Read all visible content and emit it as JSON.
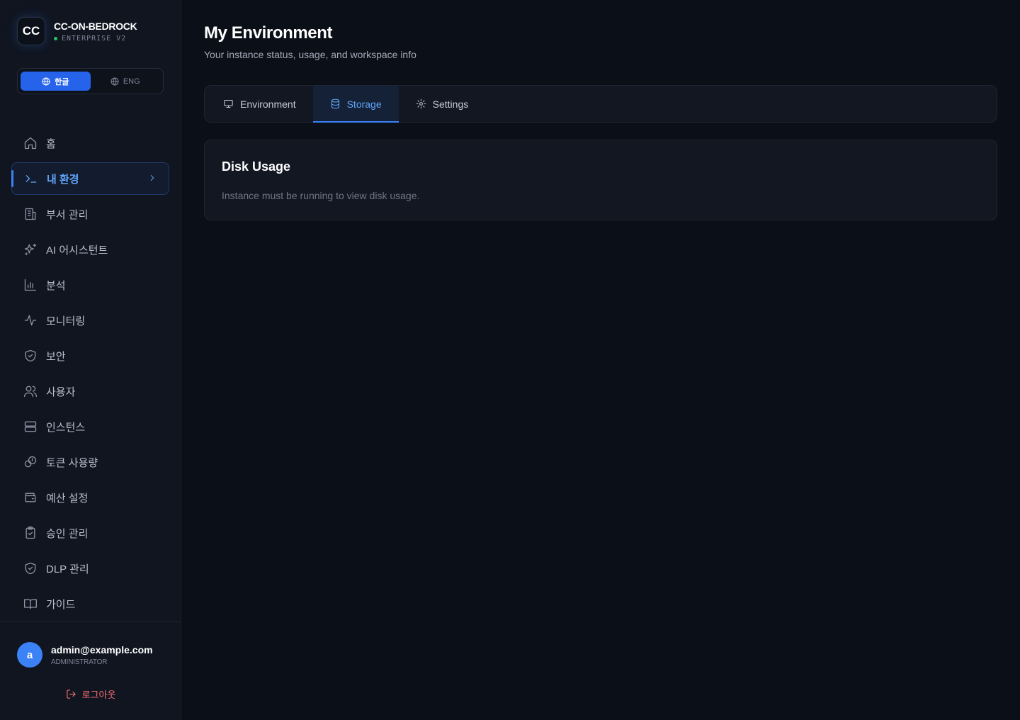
{
  "brand": {
    "logo_text": "CC",
    "name": "CC-ON-BEDROCK",
    "edition": "ENTERPRISE V2",
    "status_color": "#22c55e"
  },
  "language": {
    "options": [
      {
        "label": "한글",
        "icon": "globe-icon",
        "active": true
      },
      {
        "label": "ENG",
        "icon": "globe-icon",
        "active": false
      }
    ]
  },
  "nav": {
    "items": [
      {
        "label": "홈",
        "icon": "home-icon"
      },
      {
        "label": "내 환경",
        "icon": "terminal-icon",
        "active": true
      },
      {
        "label": "부서 관리",
        "icon": "building-icon"
      },
      {
        "label": "AI 어시스턴트",
        "icon": "sparkles-icon"
      },
      {
        "label": "분석",
        "icon": "bar-chart-icon"
      },
      {
        "label": "모니터링",
        "icon": "activity-icon"
      },
      {
        "label": "보안",
        "icon": "shield-check-icon"
      },
      {
        "label": "사용자",
        "icon": "users-icon"
      },
      {
        "label": "인스턴스",
        "icon": "server-icon"
      },
      {
        "label": "토큰 사용량",
        "icon": "coins-icon"
      },
      {
        "label": "예산 설정",
        "icon": "wallet-icon"
      },
      {
        "label": "승인 관리",
        "icon": "clipboard-check-icon"
      },
      {
        "label": "DLP 관리",
        "icon": "shield-check-icon"
      },
      {
        "label": "가이드",
        "icon": "book-open-icon"
      }
    ]
  },
  "user": {
    "avatar_letter": "a",
    "email": "admin@example.com",
    "role": "ADMINISTRATOR",
    "logout_label": "로그아웃"
  },
  "page": {
    "title": "My Environment",
    "subtitle": "Your instance status, usage, and workspace info"
  },
  "tabs": [
    {
      "label": "Environment",
      "icon": "monitor-icon",
      "active": false
    },
    {
      "label": "Storage",
      "icon": "database-icon",
      "active": true
    },
    {
      "label": "Settings",
      "icon": "gear-icon",
      "active": false
    }
  ],
  "disk_card": {
    "title": "Disk Usage",
    "message": "Instance must be running to view disk usage."
  },
  "colors": {
    "accent": "#3b82f6",
    "background": "#0b0f17",
    "sidebar": "#101520",
    "danger": "#f87171"
  }
}
